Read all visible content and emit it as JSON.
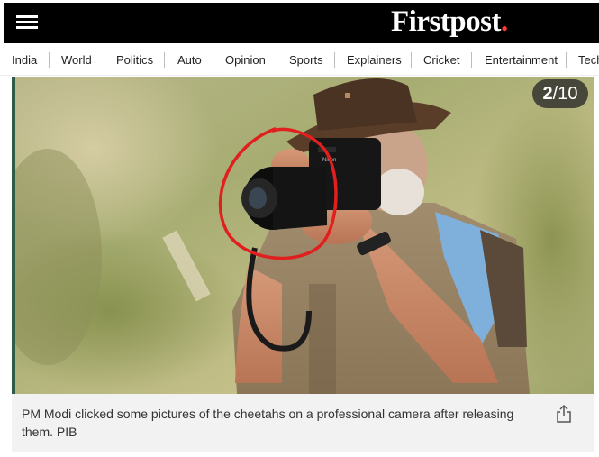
{
  "header": {
    "logo_text": "Firstpost",
    "logo_dot": ".",
    "menu_icon": "hamburger-menu-icon"
  },
  "nav": {
    "items": [
      "India",
      "World",
      "Politics",
      "Auto",
      "Opinion",
      "Sports",
      "Explainers",
      "Cricket",
      "Entertainment",
      "Tech"
    ]
  },
  "gallery": {
    "current": "2",
    "total": "/10",
    "image_description": "Man in brown hat and khaki vest photographing with a Nikon camera, lens circled in red",
    "caption": "PM Modi clicked some pictures of the cheetahs on a professional camera after releasing them. PIB",
    "share_icon": "share-icon"
  },
  "colors": {
    "brand_dot": "#ff3d2e",
    "topbar": "#000000",
    "caption_bg": "#f2f2f2",
    "annotation": "#e0201f"
  }
}
